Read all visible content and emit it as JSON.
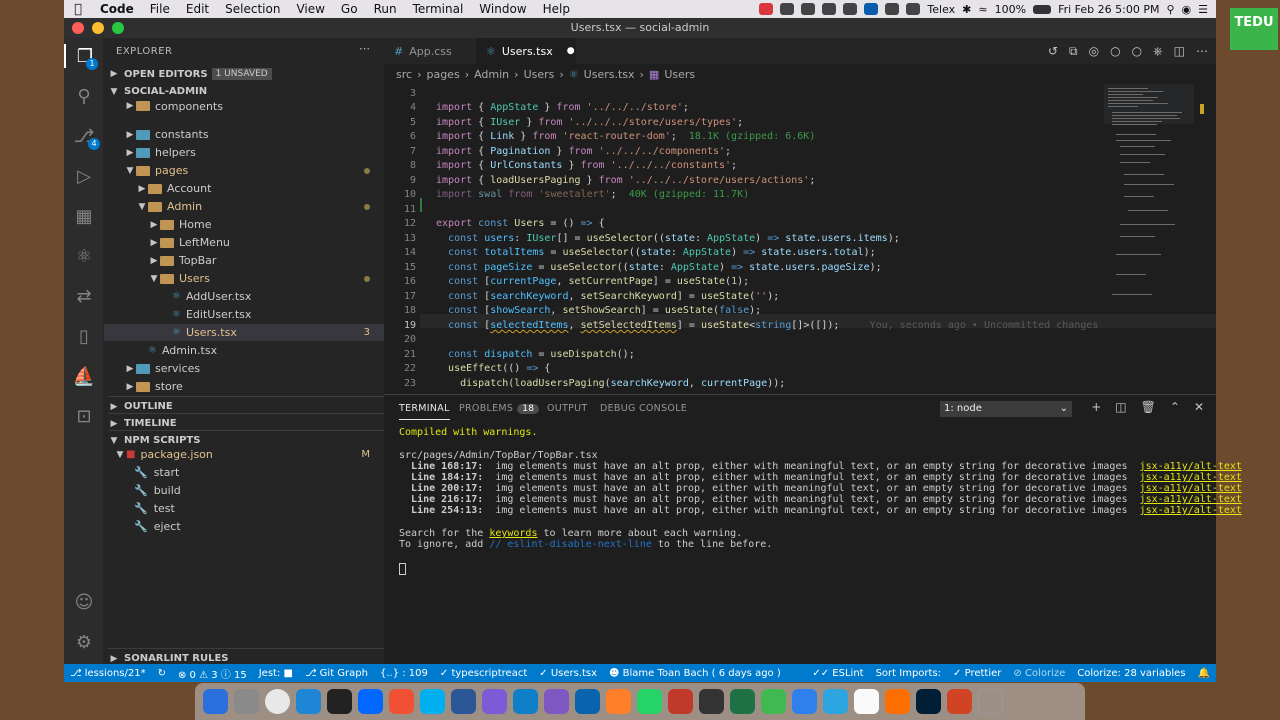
{
  "menubar": {
    "items": [
      "Code",
      "File",
      "Edit",
      "Selection",
      "View",
      "Go",
      "Run",
      "Terminal",
      "Window",
      "Help"
    ],
    "telex": "Telex",
    "battery": "100%",
    "clock": "Fri Feb 26  5:00 PM"
  },
  "window": {
    "title": "Users.tsx — social-admin"
  },
  "explorer": {
    "title": "EXPLORER",
    "open_editors": "OPEN EDITORS",
    "unsaved": "1 UNSAVED",
    "project": "SOCIAL-ADMIN",
    "tree": [
      {
        "label": "components",
        "kind": "folder"
      },
      {
        "label": "constants",
        "kind": "folder"
      },
      {
        "label": "helpers",
        "kind": "folder"
      },
      {
        "label": "pages",
        "kind": "folder"
      },
      {
        "label": "Account",
        "kind": "folder"
      },
      {
        "label": "Admin",
        "kind": "folder"
      },
      {
        "label": "Home",
        "kind": "folder"
      },
      {
        "label": "LeftMenu",
        "kind": "folder"
      },
      {
        "label": "TopBar",
        "kind": "folder"
      },
      {
        "label": "Users",
        "kind": "folder"
      },
      {
        "label": "AddUser.tsx",
        "kind": "tsx"
      },
      {
        "label": "EditUser.tsx",
        "kind": "tsx"
      },
      {
        "label": "Users.tsx",
        "kind": "tsx",
        "problems": "3"
      },
      {
        "label": "Admin.tsx",
        "kind": "tsx"
      },
      {
        "label": "services",
        "kind": "folder"
      },
      {
        "label": "store",
        "kind": "folder"
      }
    ],
    "outline": "OUTLINE",
    "timeline": "TIMELINE",
    "npm_scripts": "NPM SCRIPTS",
    "package_json": "package.json",
    "package_mod": "M",
    "scripts": [
      "start",
      "build",
      "test",
      "eject"
    ],
    "sonarlint": "SONARLINT RULES"
  },
  "tabs": [
    {
      "label": "App.css"
    },
    {
      "label": "Users.tsx"
    }
  ],
  "breadcrumb": [
    "src",
    "pages",
    "Admin",
    "Users",
    "Users.tsx",
    "Users"
  ],
  "editor": {
    "lines": [
      "3",
      "4",
      "5",
      "6",
      "7",
      "8",
      "9",
      "10",
      "11",
      "12",
      "13",
      "14",
      "15",
      "16",
      "17",
      "18",
      "19",
      "20",
      "21",
      "22",
      "23"
    ],
    "current_line": "19",
    "blame": "You, seconds ago • Uncommitted changes",
    "size_hint_router": "18.1K (gzipped: 6.6K)",
    "size_hint_swal": "40K (gzipped: 11.7K)"
  },
  "panel": {
    "tabs": {
      "terminal": "TERMINAL",
      "problems": "PROBLEMS",
      "problems_count": "18",
      "output": "OUTPUT",
      "debug": "DEBUG CONSOLE"
    },
    "terminal_select": "1: node",
    "compiled": "Compiled with warnings.",
    "file": "src/pages/Admin/TopBar/TopBar.tsx",
    "warnings": [
      {
        "loc": "Line 168:17:",
        "msg": "img elements must have an alt prop, either with meaningful text, or an empty string for decorative images",
        "rule": "jsx-a11y/alt-text"
      },
      {
        "loc": "Line 184:17:",
        "msg": "img elements must have an alt prop, either with meaningful text, or an empty string for decorative images",
        "rule": "jsx-a11y/alt-text"
      },
      {
        "loc": "Line 200:17:",
        "msg": "img elements must have an alt prop, either with meaningful text, or an empty string for decorative images",
        "rule": "jsx-a11y/alt-text"
      },
      {
        "loc": "Line 216:17:",
        "msg": "img elements must have an alt prop, either with meaningful text, or an empty string for decorative images",
        "rule": "jsx-a11y/alt-text"
      },
      {
        "loc": "Line 254:13:",
        "msg": "img elements must have an alt prop, either with meaningful text, or an empty string for decorative images",
        "rule": "jsx-a11y/alt-text"
      }
    ],
    "search_pre": "Search for the ",
    "search_kw": "keywords",
    "search_post": " to learn more about each warning.",
    "ignore_pre": "To ignore, add ",
    "ignore_kw": "// eslint-disable-next-line",
    "ignore_post": " to the line before."
  },
  "statusbar": {
    "branch": "lessions/21*",
    "errors": "0",
    "warnings": "3",
    "info": "15",
    "jest": "Jest:",
    "gitgraph": "Git Graph",
    "position": "{..} : 109",
    "language": "typescriptreact",
    "file": "Users.tsx",
    "blame": "Blame Toan Bach ( 6 days ago )",
    "eslint": "ESLint",
    "sort_imports": "Sort Imports:",
    "prettier": "Prettier",
    "colorize": "Colorize",
    "colorize_vars": "Colorize: 28 variables"
  },
  "brand": {
    "logo_text": "TEDU"
  },
  "colors": {
    "accent": "#007acc",
    "sidebar": "#252526",
    "editor": "#1e1e1e"
  }
}
